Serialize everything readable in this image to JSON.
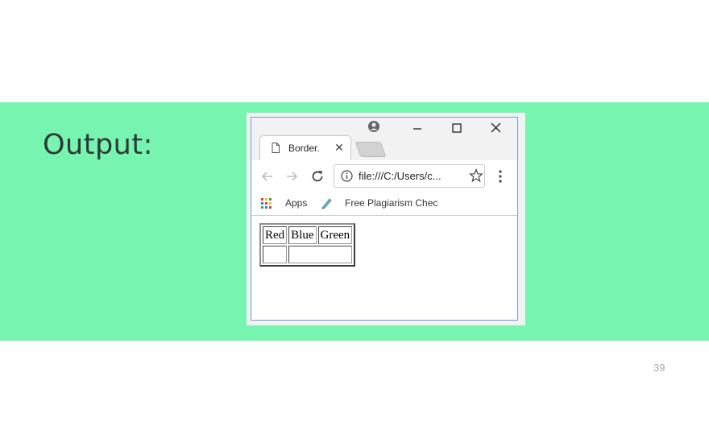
{
  "slide": {
    "title": "Output:",
    "page_number": "39"
  },
  "browser": {
    "tab": {
      "title": "Border.",
      "close": "✕"
    },
    "address": {
      "url": "file:///C:/Users/c..."
    },
    "bookmarks": {
      "apps_label": "Apps",
      "item_label": "Free Plagiarism Chec"
    },
    "icons": [
      "page-icon",
      "profile-icon",
      "minimize-icon",
      "maximize-icon",
      "close-icon",
      "back-icon",
      "forward-icon",
      "reload-icon",
      "info-icon",
      "star-icon",
      "menu-icon",
      "apps-grid-icon",
      "bookmark-icon"
    ]
  },
  "table": {
    "headers": [
      "Red",
      "Blue",
      "Green"
    ],
    "rows": [
      [
        "",
        ""
      ]
    ]
  },
  "colors": {
    "band": "#76f4b0",
    "window_border": "#6f9bd1"
  }
}
